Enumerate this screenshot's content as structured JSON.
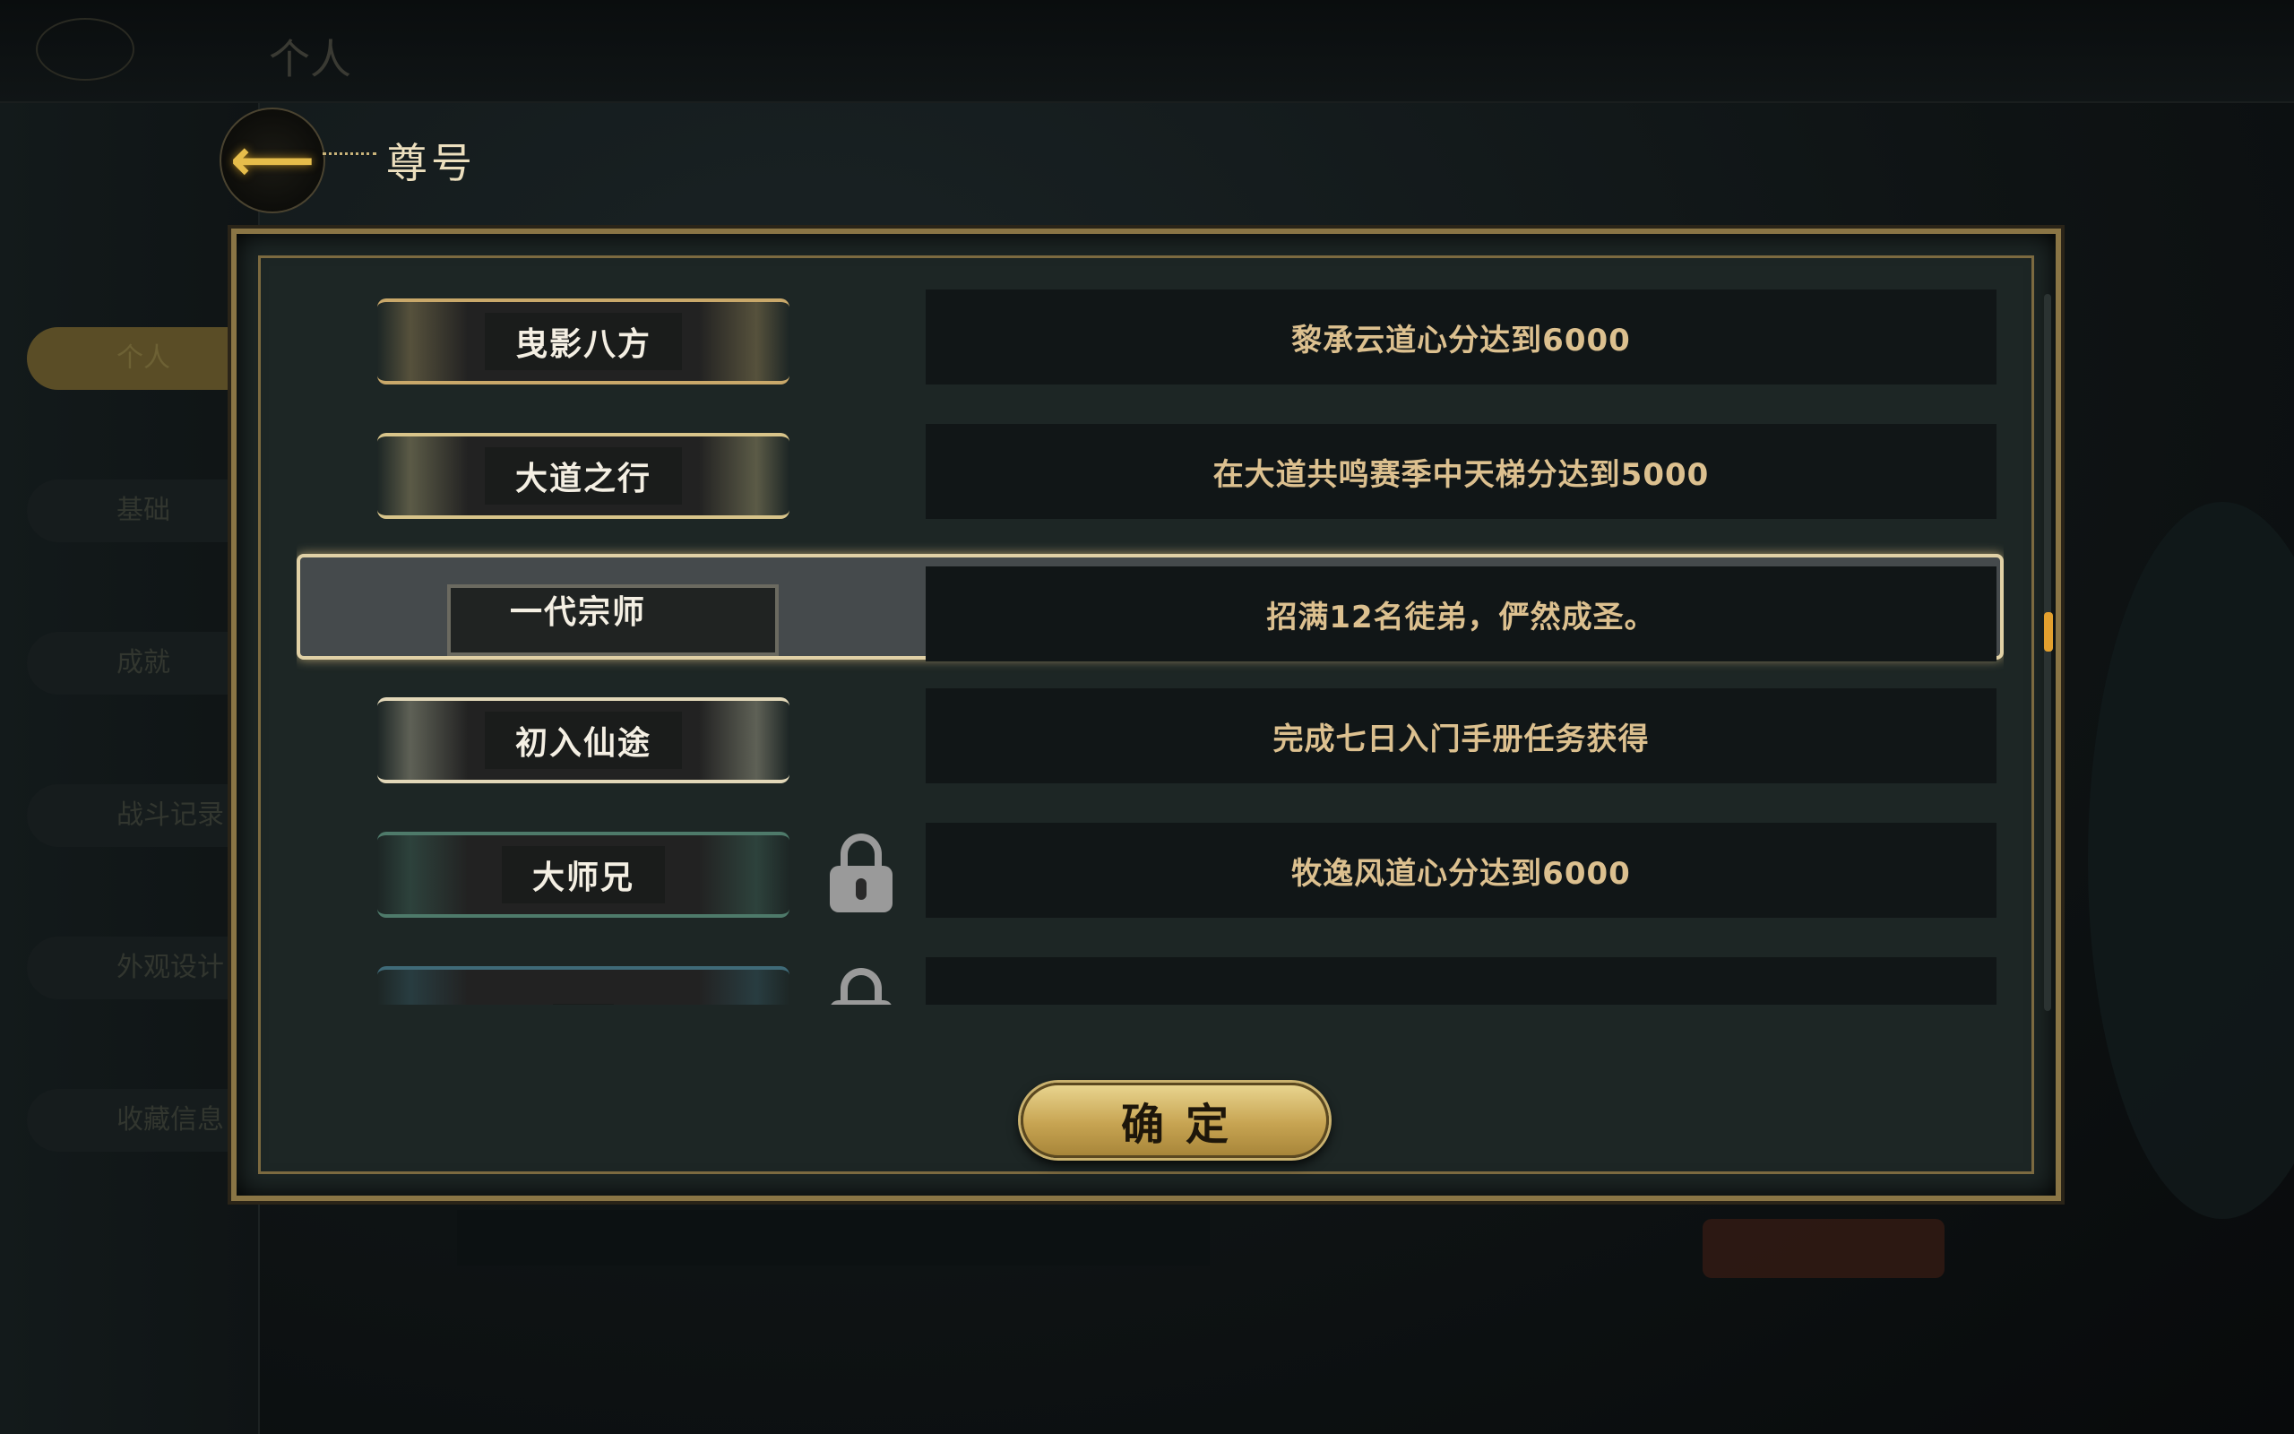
{
  "background": {
    "top_title": "个人",
    "side_items": [
      "个人",
      "基础",
      "成就",
      "战斗记录",
      "外观设计",
      "收藏信息"
    ]
  },
  "header": {
    "title": "尊号",
    "back_icon": "back-arrow-icon"
  },
  "titles": [
    {
      "name": "曳影八方",
      "condition": "黎承云道心分达到6000",
      "locked": false,
      "selected": false,
      "accent": "#c9a86a"
    },
    {
      "name": "大道之行",
      "condition": "在大道共鸣赛季中天梯分达到5000",
      "locked": false,
      "selected": false,
      "accent": "#d8c48a"
    },
    {
      "name": "一代宗师",
      "condition": "招满12名徒弟，俨然成圣。",
      "locked": false,
      "selected": true,
      "accent": "#6b6a60"
    },
    {
      "name": "初入仙途",
      "condition": "完成七日入门手册任务获得",
      "locked": false,
      "selected": false,
      "accent": "#e2d7b8"
    },
    {
      "name": "大师兄",
      "condition": "牧逸风道心分达到6000",
      "locked": true,
      "selected": false,
      "accent": "#4e7a6a"
    },
    {
      "name": "",
      "condition": "",
      "locked": true,
      "selected": false,
      "accent": "#3f6a78"
    }
  ],
  "confirm_label": "确定",
  "colors": {
    "gold": "#e6bd4b",
    "condition_text": "#dcc08f",
    "scroll_thumb": "#e2a02e"
  }
}
